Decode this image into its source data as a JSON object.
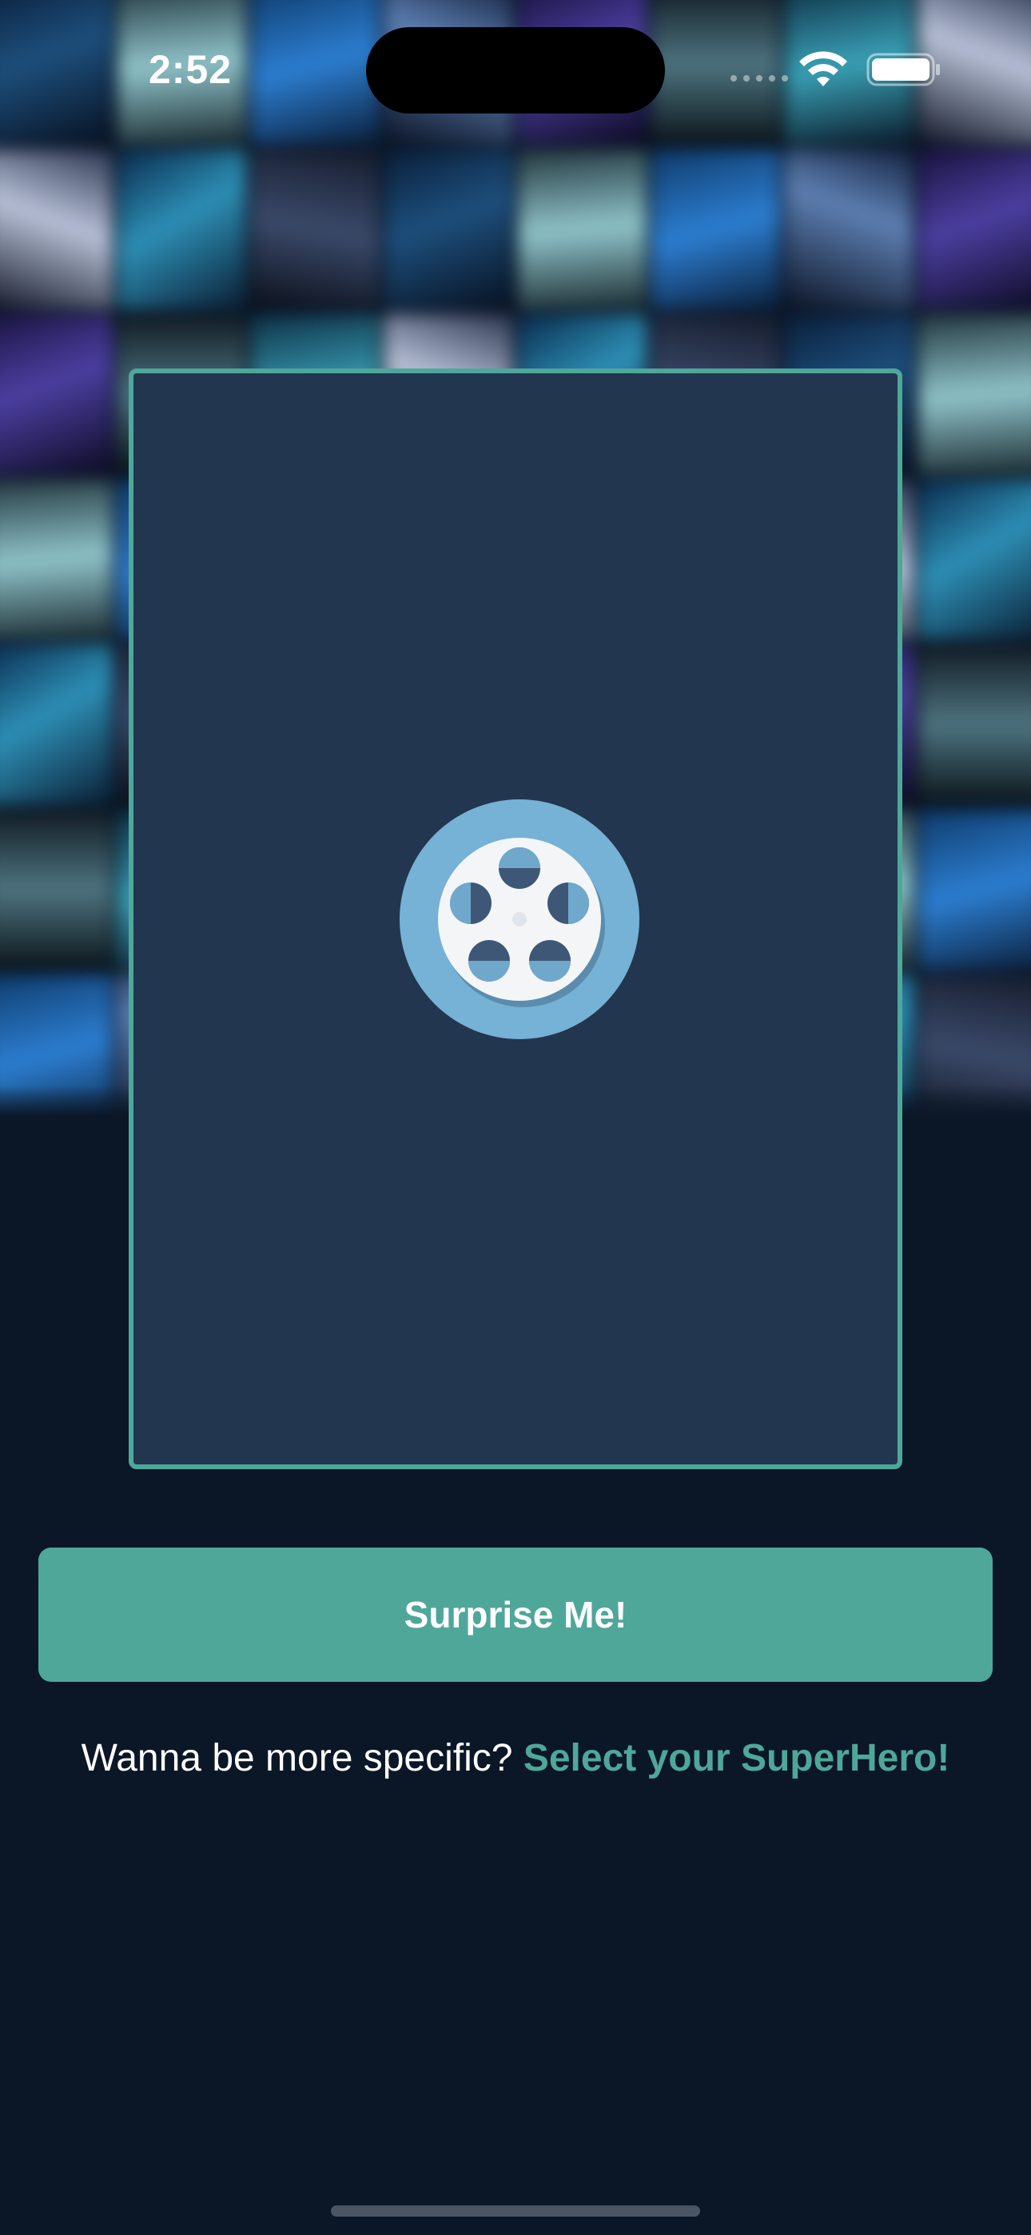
{
  "status_bar": {
    "time": "2:52",
    "wifi_icon": "wifi-icon",
    "battery_icon": "battery-icon"
  },
  "poster_card": {
    "placeholder_icon": "film-reel-icon"
  },
  "actions": {
    "surprise_label": "Surprise Me!",
    "prompt_text": "Wanna be more specific?",
    "select_link_label": "Select your SuperHero!"
  },
  "colors": {
    "background": "#0b1727",
    "card": "#22364f",
    "accent": "#4fa79a",
    "reel_outer": "#76b1d6"
  }
}
